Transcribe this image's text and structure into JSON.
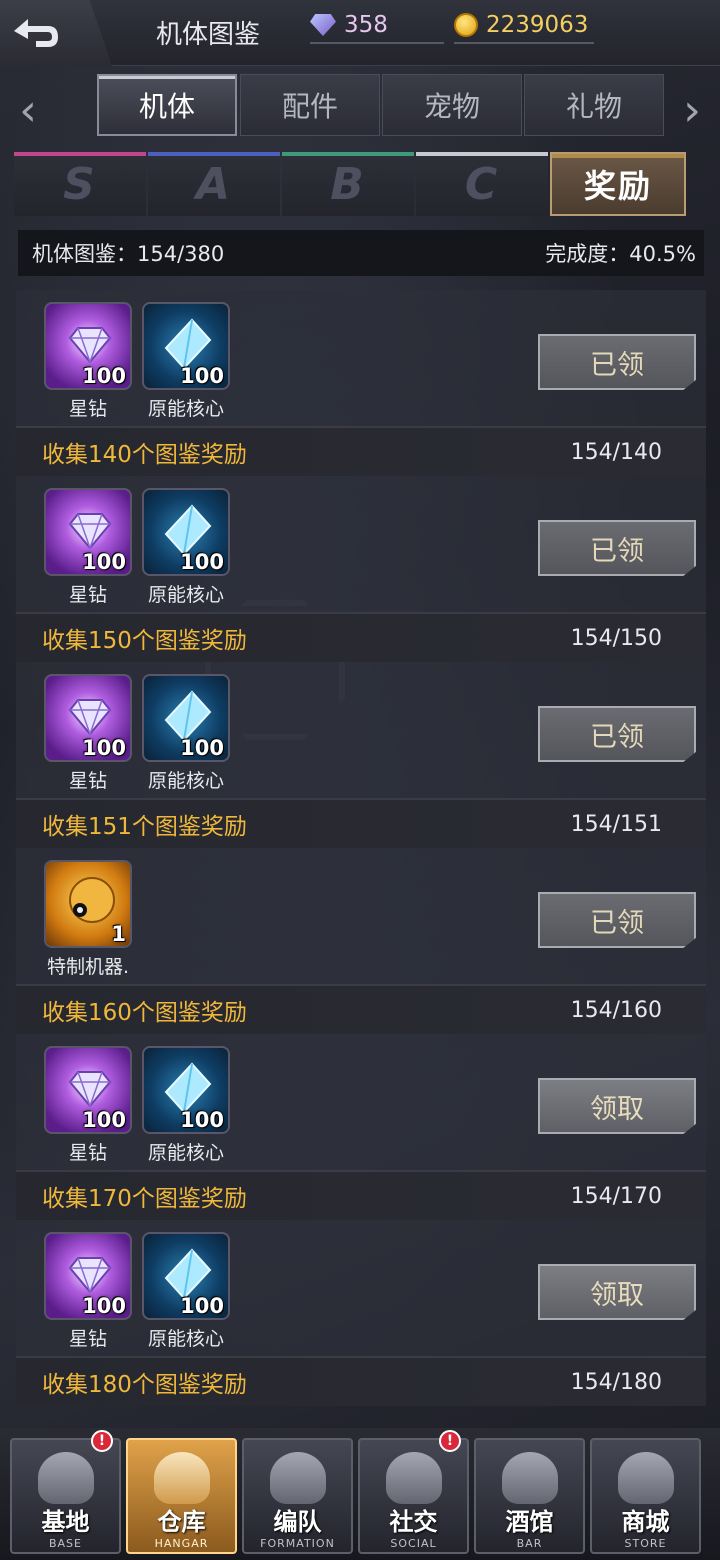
{
  "header": {
    "title": "机体图鉴",
    "gems": "358",
    "coins": "2239063"
  },
  "tabs": [
    {
      "label": "机体",
      "active": true
    },
    {
      "label": "配件",
      "active": false
    },
    {
      "label": "宠物",
      "active": false
    },
    {
      "label": "礼物",
      "active": false
    }
  ],
  "grades": [
    {
      "label": "S",
      "color": "#c0478f"
    },
    {
      "label": "A",
      "color": "#4d5fbe"
    },
    {
      "label": "B",
      "color": "#3f9a7c"
    },
    {
      "label": "C",
      "color": "#c9c9d2"
    },
    {
      "label": "奖励",
      "color": "#b08a48",
      "active": true
    }
  ],
  "summary": {
    "collected": "机体图鉴：154/380",
    "completion": "完成度：40.5%"
  },
  "rewards": [
    {
      "title": "",
      "progress": "",
      "items": [
        {
          "name": "星钻",
          "qty": "100",
          "type": "star"
        },
        {
          "name": "原能核心",
          "qty": "100",
          "type": "core"
        }
      ],
      "button": "已领"
    },
    {
      "title": "收集140个图鉴奖励",
      "progress": "154/140",
      "items": [
        {
          "name": "星钻",
          "qty": "100",
          "type": "star"
        },
        {
          "name": "原能核心",
          "qty": "100",
          "type": "core"
        }
      ],
      "button": "已领"
    },
    {
      "title": "收集150个图鉴奖励",
      "progress": "154/150",
      "items": [
        {
          "name": "星钻",
          "qty": "100",
          "type": "star"
        },
        {
          "name": "原能核心",
          "qty": "100",
          "type": "core"
        }
      ],
      "button": "已领"
    },
    {
      "title": "收集151个图鉴奖励",
      "progress": "154/151",
      "items": [
        {
          "name": "特制机器.",
          "qty": "1",
          "type": "robot"
        }
      ],
      "button": "已领"
    },
    {
      "title": "收集160个图鉴奖励",
      "progress": "154/160",
      "items": [
        {
          "name": "星钻",
          "qty": "100",
          "type": "star"
        },
        {
          "name": "原能核心",
          "qty": "100",
          "type": "core"
        }
      ],
      "button": "领取"
    },
    {
      "title": "收集170个图鉴奖励",
      "progress": "154/170",
      "items": [
        {
          "name": "星钻",
          "qty": "100",
          "type": "star"
        },
        {
          "name": "原能核心",
          "qty": "100",
          "type": "core"
        }
      ],
      "button": "领取"
    },
    {
      "title": "收集180个图鉴奖励",
      "progress": "154/180",
      "items": [],
      "button": ""
    }
  ],
  "nav": [
    {
      "label": "基地",
      "sub": "BASE",
      "badge": "!",
      "active": false
    },
    {
      "label": "仓库",
      "sub": "HANGAR",
      "badge": "",
      "active": true
    },
    {
      "label": "编队",
      "sub": "FORMATION",
      "badge": "",
      "active": false
    },
    {
      "label": "社交",
      "sub": "SOCIAL",
      "badge": "!",
      "active": false
    },
    {
      "label": "酒馆",
      "sub": "BAR",
      "badge": "",
      "active": false
    },
    {
      "label": "商城",
      "sub": "STORE",
      "badge": "",
      "active": false
    }
  ]
}
